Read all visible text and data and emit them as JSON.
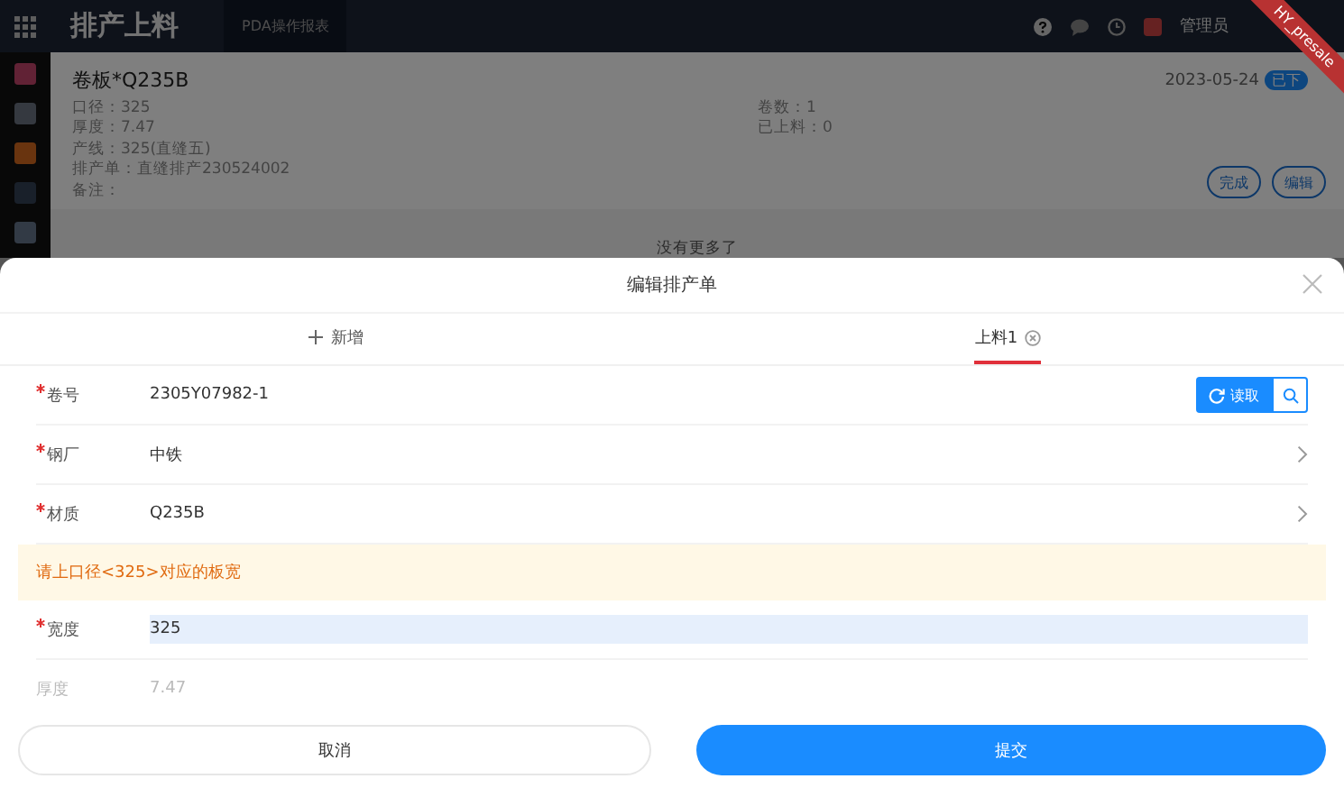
{
  "header": {
    "title": "排产上料",
    "tab": "PDA操作报表",
    "user": "管理员"
  },
  "ribbon": "HY_presale",
  "card": {
    "title": "卷板*Q235B",
    "date": "2023-05-24",
    "status": "已下",
    "fields": [
      {
        "label": "口径：",
        "value": "325"
      },
      {
        "label": "厚度：",
        "value": "7.47"
      },
      {
        "label": "产线：",
        "value": "325(直缝五)"
      },
      {
        "label": "排产单：",
        "value": "直缝排产230524002"
      },
      {
        "label": "备注："
      }
    ],
    "right_fields": [
      {
        "label": "卷数：",
        "value": "1"
      },
      {
        "label": "已上料：",
        "value": "0"
      }
    ],
    "buttons": [
      "完成",
      "编辑"
    ]
  },
  "list_end": "没有更多了",
  "modal": {
    "title": "编辑排产单",
    "tabs": [
      {
        "kind": "add",
        "label": "新增",
        "selected": false
      },
      {
        "kind": "item",
        "label": "上料1",
        "selected": true
      }
    ],
    "fields": [
      {
        "kind": "scan",
        "label": "卷号",
        "required": true,
        "value": "2305Y07982-1",
        "button": "读取"
      },
      {
        "kind": "select",
        "label": "钢厂",
        "required": true,
        "value": "中铁"
      },
      {
        "kind": "select",
        "label": "材质",
        "required": true,
        "value": "Q235B"
      },
      {
        "kind": "notice",
        "text": "请上口径<325>对应的板宽"
      },
      {
        "kind": "input",
        "label": "宽度",
        "required": true,
        "value": "325"
      },
      {
        "kind": "readonly",
        "label": "厚度",
        "required": false,
        "value": "7.47"
      }
    ],
    "buttons": [
      {
        "kind": "cancel",
        "label": "取消"
      },
      {
        "kind": "submit",
        "label": "提交"
      }
    ]
  }
}
